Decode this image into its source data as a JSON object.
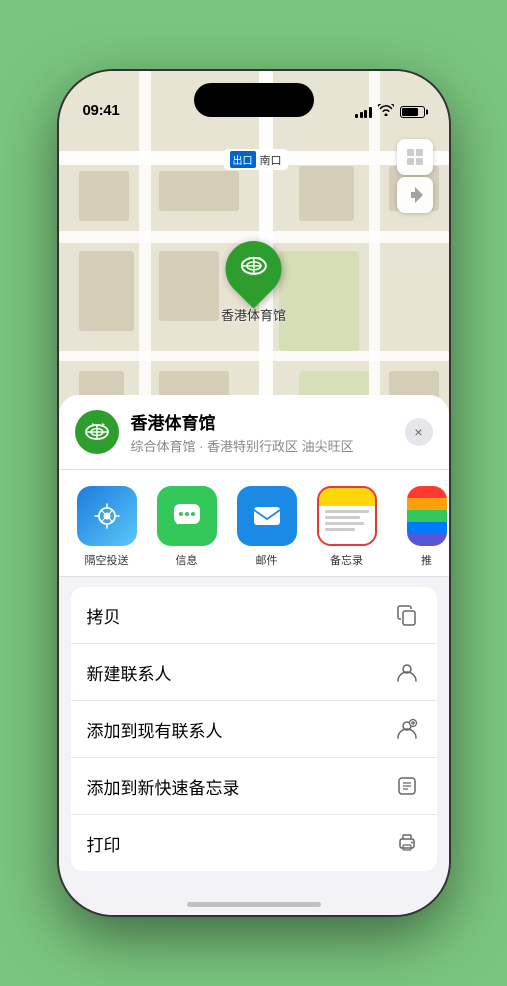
{
  "status_bar": {
    "time": "09:41",
    "location_arrow": "▶"
  },
  "map": {
    "label_prefix": "出口",
    "label_text": "南口",
    "stadium_name": "香港体育馆",
    "controls": {
      "map_icon": "🗺",
      "location_icon": "⬆"
    }
  },
  "location_card": {
    "name": "香港体育馆",
    "description": "综合体育馆 · 香港特别行政区 油尖旺区",
    "close_label": "×"
  },
  "share_items": [
    {
      "id": "airdrop",
      "label": "隔空投送"
    },
    {
      "id": "messages",
      "label": "信息"
    },
    {
      "id": "mail",
      "label": "邮件"
    },
    {
      "id": "notes",
      "label": "备忘录"
    },
    {
      "id": "more",
      "label": "推"
    }
  ],
  "action_items": [
    {
      "id": "copy",
      "label": "拷贝",
      "icon": "copy"
    },
    {
      "id": "new-contact",
      "label": "新建联系人",
      "icon": "contact"
    },
    {
      "id": "add-existing",
      "label": "添加到现有联系人",
      "icon": "add-contact"
    },
    {
      "id": "quick-note",
      "label": "添加到新快速备忘录",
      "icon": "quick-note"
    },
    {
      "id": "print",
      "label": "打印",
      "icon": "print"
    }
  ]
}
